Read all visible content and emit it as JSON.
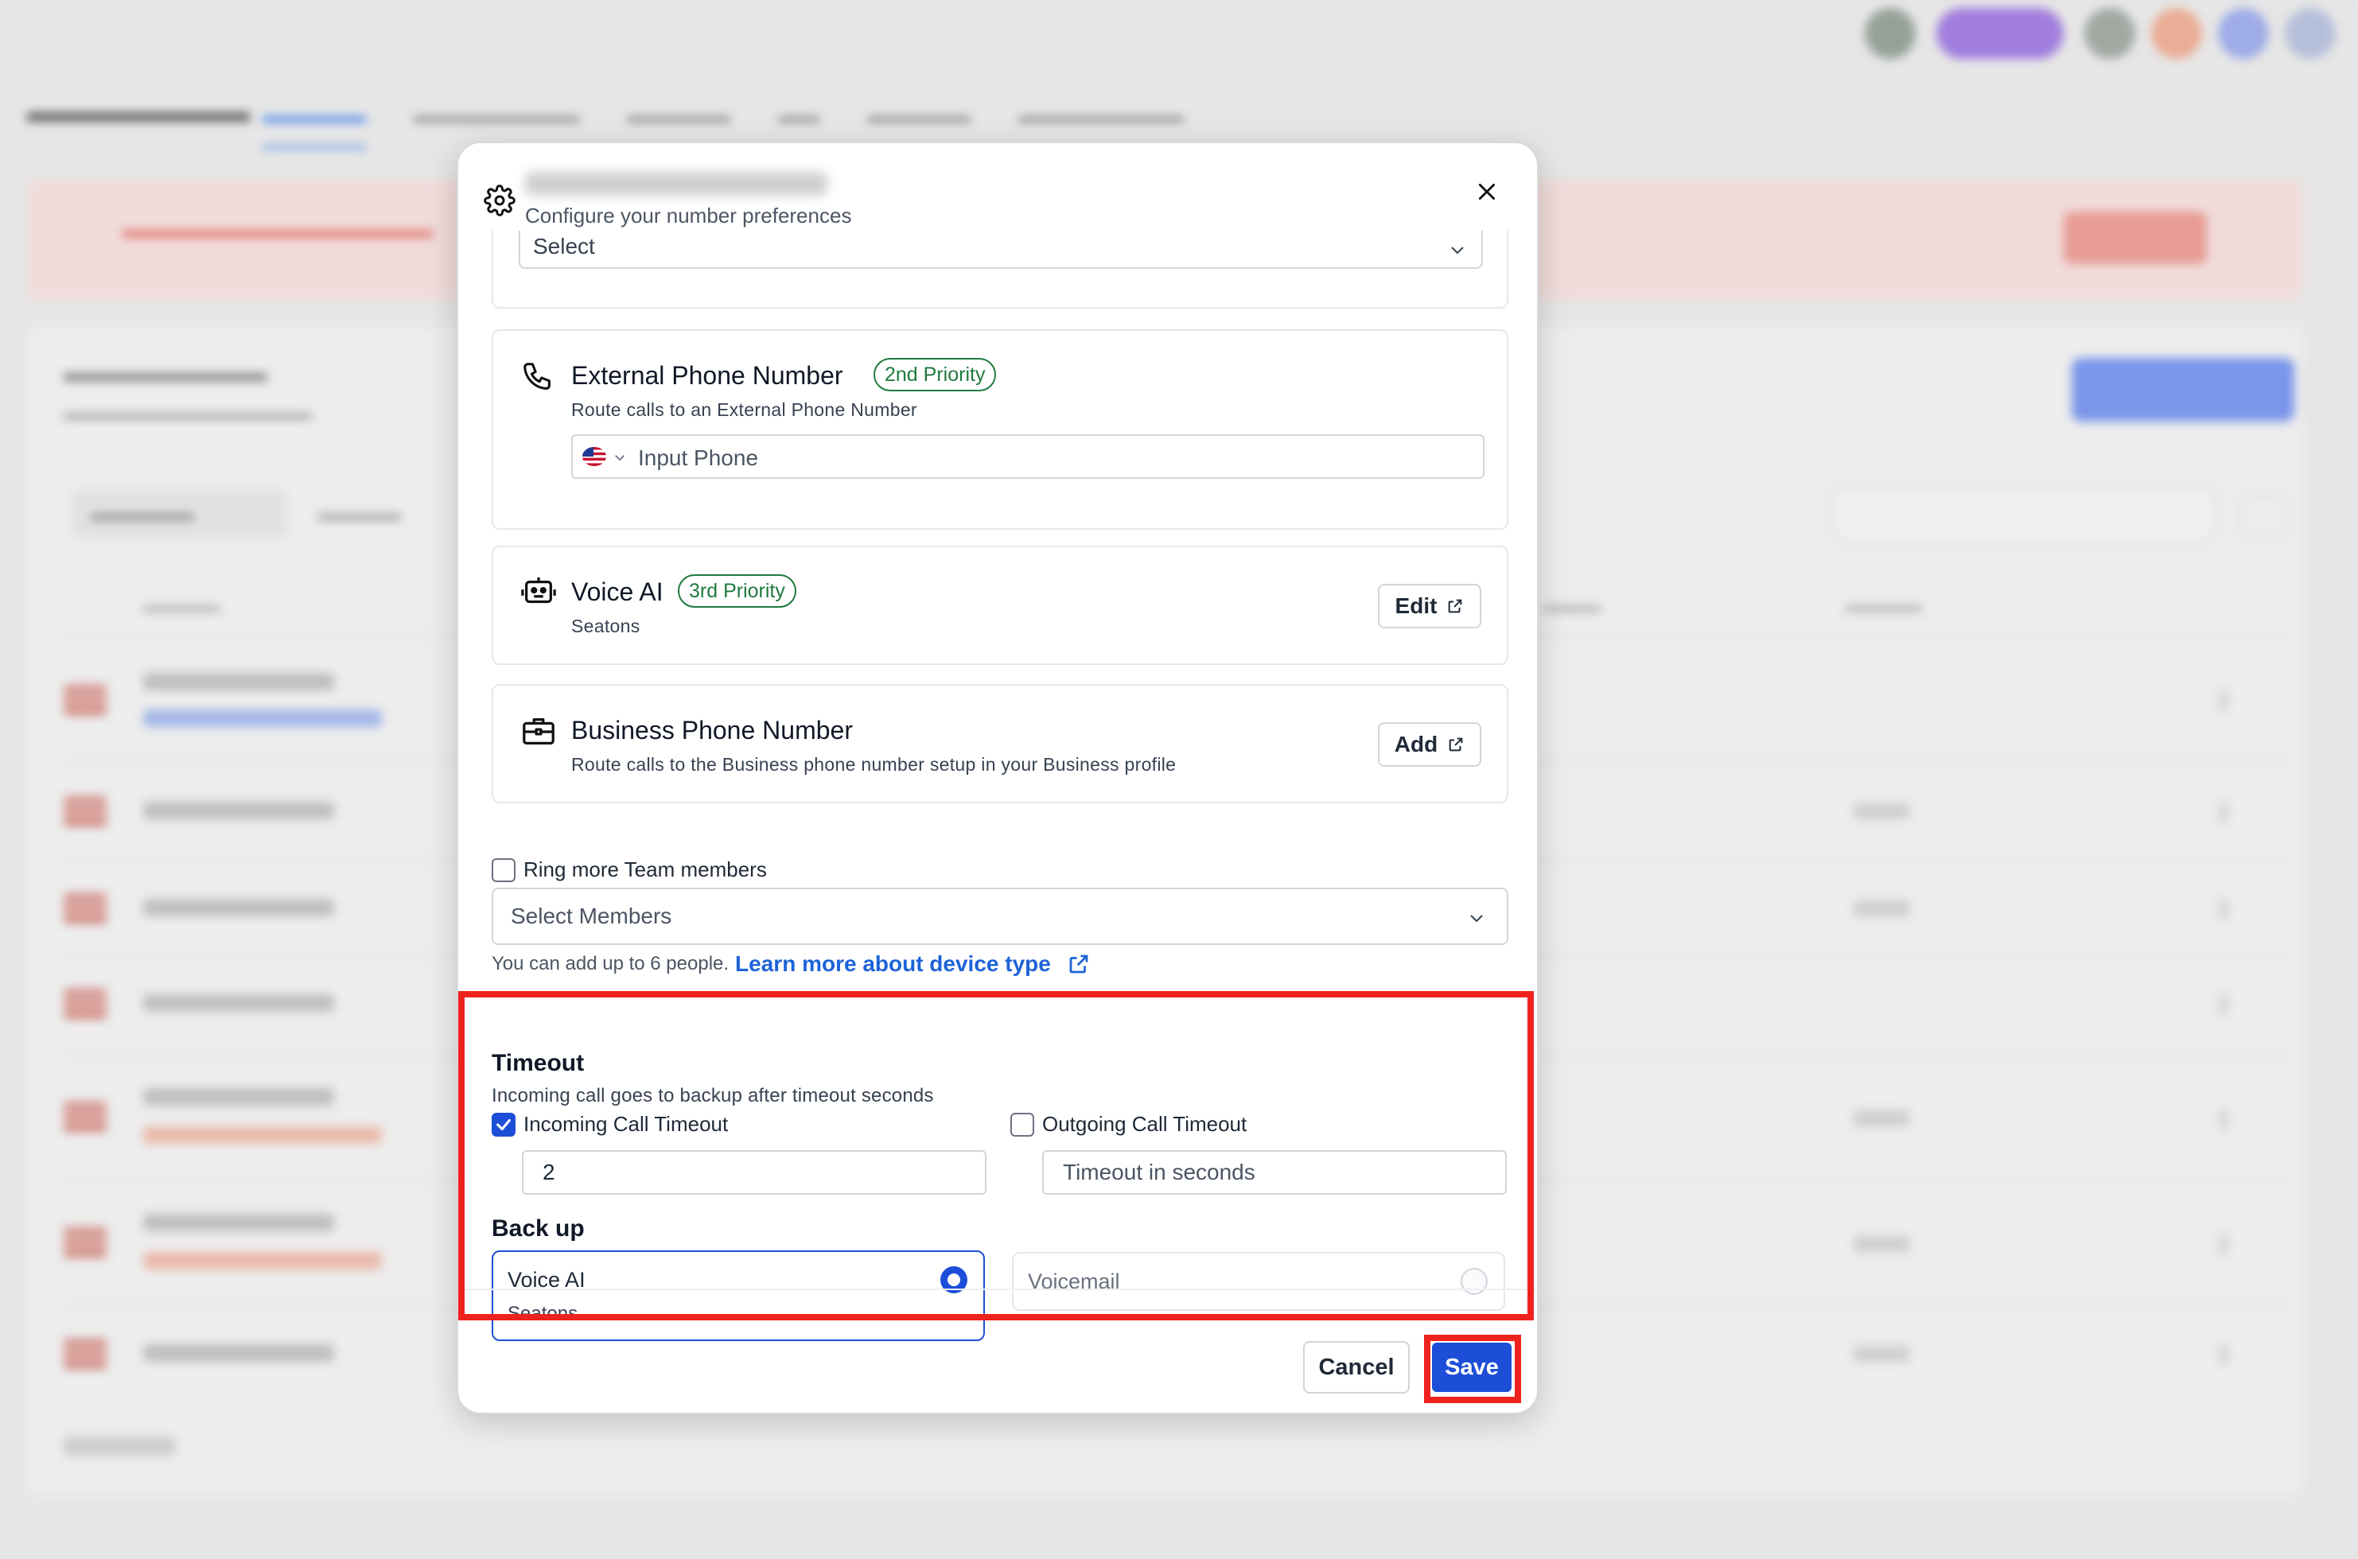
{
  "modal": {
    "subtitle": "Configure your number preferences",
    "top_select": {
      "value": "Select"
    },
    "external_phone": {
      "title": "External Phone Number",
      "priority": "2nd Priority",
      "description": "Route calls to an External Phone Number",
      "phone_placeholder": "Input Phone"
    },
    "voice_ai": {
      "title": "Voice AI",
      "priority": "3rd Priority",
      "description": "Seatons",
      "button": "Edit"
    },
    "business_phone": {
      "title": "Business Phone Number",
      "description": "Route calls to the Business phone number setup in your Business profile",
      "button": "Add"
    },
    "ring_more": {
      "label": "Ring more Team members",
      "checked": false,
      "select_placeholder": "Select Members",
      "helper": "You can add up to 6 people.",
      "helper_link": "Learn more about device type"
    },
    "timeout": {
      "title": "Timeout",
      "description": "Incoming call goes to backup after timeout seconds",
      "incoming_label": "Incoming Call Timeout",
      "incoming_checked": true,
      "incoming_value": "2",
      "outgoing_label": "Outgoing Call Timeout",
      "outgoing_checked": false,
      "outgoing_placeholder": "Timeout in seconds"
    },
    "backup": {
      "title": "Back up",
      "options": [
        {
          "name": "Voice AI",
          "sub": "Seatons",
          "selected": true
        },
        {
          "name": "Voicemail",
          "sub": "",
          "selected": false
        }
      ]
    },
    "footer": {
      "cancel": "Cancel",
      "save": "Save"
    }
  },
  "colors": {
    "accent": "#1d4ed8",
    "priority_green": "#1f7a3e",
    "highlight_red": "#f0221d",
    "link_blue": "#1d63d8"
  },
  "icons": [
    "gear-icon",
    "close-icon",
    "chevron-down-icon",
    "phone-icon",
    "robot-icon",
    "briefcase-icon",
    "external-link-icon",
    "us-flag-icon",
    "check-icon"
  ]
}
